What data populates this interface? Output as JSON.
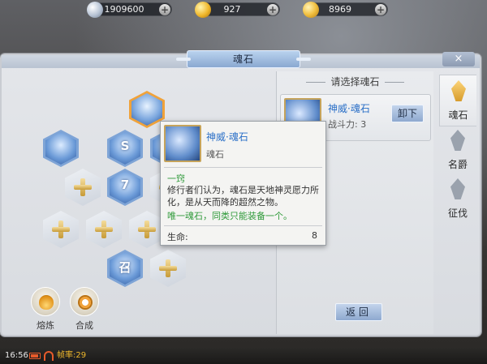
{
  "currency": {
    "silver": {
      "value": "1909600",
      "icon": "silver-coin-icon"
    },
    "gold": {
      "value": "927",
      "icon": "gold-coin-icon"
    },
    "ingot": {
      "value": "8969",
      "icon": "gold-ingot-icon"
    },
    "add_symbol": "+"
  },
  "panel": {
    "title": "魂石",
    "close_symbol": "×"
  },
  "actions": [
    {
      "label": "熔炼",
      "icon": "refine-flame-icon"
    },
    {
      "label": "合成",
      "icon": "merge-ring-icon"
    }
  ],
  "hex_stones": {
    "stone_glyphs": [
      "",
      "",
      "S",
      "7",
      "召"
    ]
  },
  "right_panel": {
    "heading": "请选择魂石",
    "entry": {
      "name": "神威·魂石",
      "power": "战斗力: 3",
      "unequip": "卸下"
    },
    "back": "返回"
  },
  "tabs": [
    {
      "label": "魂石",
      "active": true,
      "icon": "soulstone-tab-icon"
    },
    {
      "label": "名爵",
      "active": false,
      "icon": "rank-tab-icon"
    },
    {
      "label": "征伐",
      "active": false,
      "icon": "conquest-tab-icon"
    }
  ],
  "tooltip": {
    "name": "神威·魂石",
    "type": "魂石",
    "grade": "一窍",
    "description": "修行者们认为，魂石是天地神灵愿力所化，是从天而降的超然之物。",
    "unique": "唯一魂石，同类只能装备一个。",
    "stat_name": "生命:",
    "stat_value": "8"
  },
  "status_bar": {
    "time": "16:56",
    "fps": "帧率:29"
  }
}
